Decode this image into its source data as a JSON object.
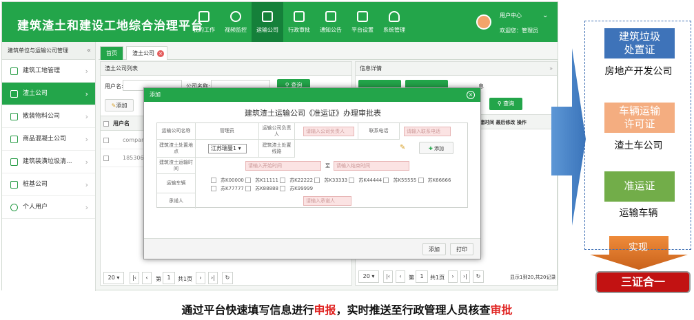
{
  "app": {
    "title": "建筑渣土和建设工地综合治理平台",
    "nav": [
      {
        "label": "我的工作",
        "icon": "clipboard-icon"
      },
      {
        "label": "视频监控",
        "icon": "camera-icon"
      },
      {
        "label": "运输公司",
        "icon": "building-icon"
      },
      {
        "label": "行政审批",
        "icon": "stamp-icon"
      },
      {
        "label": "通知公告",
        "icon": "message-icon"
      },
      {
        "label": "平台设置",
        "icon": "settings-icon"
      },
      {
        "label": "系统管理",
        "icon": "users-icon"
      }
    ],
    "user": {
      "center": "用户中心",
      "welcome": "欢迎您：管理员"
    }
  },
  "sidebar": {
    "header": "建筑单位与运输公司管理",
    "collapse": "«",
    "items": [
      {
        "label": "建筑工地管理"
      },
      {
        "label": "渣土公司"
      },
      {
        "label": "散装物料公司"
      },
      {
        "label": "商品混凝土公司"
      },
      {
        "label": "建筑装潢垃圾清..."
      },
      {
        "label": "桩基公司"
      },
      {
        "label": "个人用户"
      }
    ]
  },
  "tabs": {
    "home": "首页",
    "current": "渣土公司",
    "close": "×"
  },
  "left_panel": {
    "title": "渣土公司列表",
    "username_label": "用户名:",
    "company_label": "公司名称:",
    "query": "查询",
    "add": "添加",
    "col_username": "用户名",
    "rows": [
      "company",
      "185306217"
    ],
    "page_size": "20",
    "page_prefix": "第",
    "page_no": "1",
    "page_total": "共1页"
  },
  "right_panel": {
    "title": "信息详情",
    "expand": "»",
    "tab_suffix": "息",
    "query": "查询",
    "cols": [
      "建时间",
      "最后修改",
      "操作"
    ],
    "page_size": "20",
    "page_prefix": "第",
    "page_no": "1",
    "page_total": "共1页",
    "record_info": "显示1到20,共20记录"
  },
  "modal": {
    "header": "添加",
    "close": "×",
    "title": "建筑渣土运输公司《准运证》办理审批表",
    "company_name_label": "运输公司名称",
    "admin": "管理员",
    "owner_label": "运输公司负责人",
    "owner_placeholder": "请输入公司负责人",
    "phone_label": "联系电话",
    "phone_placeholder": "请输入联系电话",
    "site_label": "建筑渣土处置地点",
    "site_value": "江苏瑞曼1",
    "route_label": "建筑渣土处置线路",
    "add": "添加",
    "time_label": "建筑渣土运输时间",
    "start_placeholder": "请输入开始时间",
    "to": "至",
    "end_placeholder": "请输入结束时间",
    "vehicles_label": "运输车辆",
    "plates_row1": [
      "苏K00000",
      "苏K11111",
      "苏K22222",
      "苏K33333",
      "苏K44444",
      "苏K55555",
      "苏K66666"
    ],
    "plates_row2": [
      "苏K77777",
      "苏K88888",
      "苏K99999"
    ],
    "promisor_label": "承诺人",
    "promisor_placeholder": "请输入承诺人",
    "footer_add": "添加",
    "footer_print": "打印"
  },
  "caption": {
    "part1": "通过平台快速填写信息进行",
    "em1": "申报",
    "part2": "，实时推送至行政管理人员核查",
    "em2": "审批"
  },
  "certs": [
    {
      "label": "建筑垃圾\n处置证",
      "sub": "房地产开发公司",
      "color": "#3e73b9"
    },
    {
      "label": "车辆运输\n许可证",
      "sub": "渣土车公司",
      "color": "#f4ad80"
    },
    {
      "label": "准运证",
      "sub": "运输车辆",
      "color": "#72ad49"
    }
  ],
  "realize": "实现",
  "final": "三证合一",
  "colors": {
    "accent": "#23a54a",
    "arrow": "#4a86c8",
    "final": "#c21212",
    "realize": "#e47b2a"
  }
}
